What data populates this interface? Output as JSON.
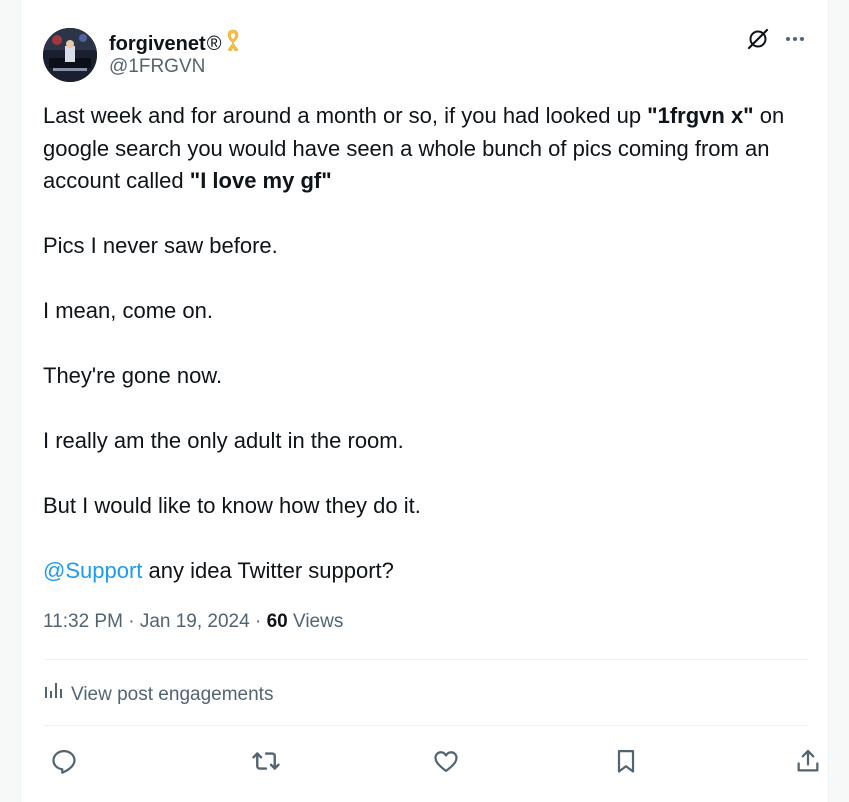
{
  "author": {
    "display_name": "forgivenet",
    "registered_mark": "®",
    "handle": "@1FRGVN"
  },
  "icons": {
    "ribbon": "yellow-ribbon-icon",
    "grok": "grok-icon",
    "more": "more-icon",
    "engagements": "bar-chart-icon",
    "reply": "reply-icon",
    "retweet": "retweet-icon",
    "like": "heart-icon",
    "bookmark": "bookmark-icon",
    "share": "share-icon"
  },
  "post": {
    "p1_before": "Last week and for around a month or so, if you had looked up ",
    "p1_bold1": "\"1frgvn x\"",
    "p1_middle": " on google search you would have seen a whole bunch of pics coming from an account called ",
    "p1_bold2": "\"I love my gf\"",
    "p2": "Pics I never saw before.",
    "p3": "I mean, come on.",
    "p4": "They're gone now.",
    "p5": "I really am the only adult in the room.",
    "p6": "But I would like to know how they do it.",
    "mention": "@Support",
    "p7_rest": " any idea Twitter support?"
  },
  "meta": {
    "time": "11:32 PM",
    "sep1": " · ",
    "date": "Jan 19, 2024",
    "sep2": " · ",
    "views_count": "60",
    "views_label": " Views"
  },
  "engagements_label": "View post engagements",
  "colors": {
    "text": "#0f1419",
    "secondary": "#536471",
    "accent": "#1d9bf0",
    "divider": "#eff3f4",
    "ribbon": "#f6c244"
  }
}
